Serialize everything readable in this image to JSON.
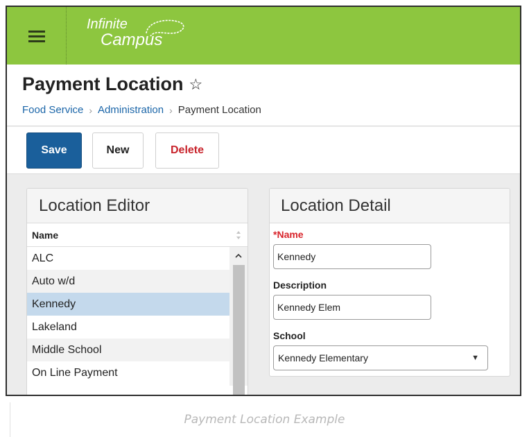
{
  "app": {
    "logo_line1": "Infinite",
    "logo_line2": "Campus",
    "brand_color": "#8dc63f"
  },
  "icons": {
    "menu": "hamburger-menu-icon",
    "favorite": "star-outline-icon",
    "sort": "sort-icon",
    "scroll_up": "chevron-up-icon",
    "dropdown": "chevron-down-icon"
  },
  "page": {
    "title": "Payment Location",
    "star": "☆"
  },
  "breadcrumb": {
    "items": [
      "Food Service",
      "Administration",
      "Payment Location"
    ],
    "separator": "›"
  },
  "toolbar": {
    "save_label": "Save",
    "new_label": "New",
    "delete_label": "Delete"
  },
  "editor": {
    "title": "Location Editor",
    "column_header": "Name",
    "rows": [
      "ALC",
      "Auto w/d",
      "Kennedy",
      "Lakeland",
      "Middle School",
      "On Line Payment"
    ],
    "selected": "Kennedy"
  },
  "detail": {
    "title": "Location Detail",
    "name_label": "Name",
    "name_required_marker": "*",
    "name_value": "Kennedy",
    "description_label": "Description",
    "description_value": "Kennedy Elem",
    "school_label": "School",
    "school_value": "Kennedy Elementary",
    "dropdown_arrow": "▼"
  },
  "caption": "Payment Location Example"
}
